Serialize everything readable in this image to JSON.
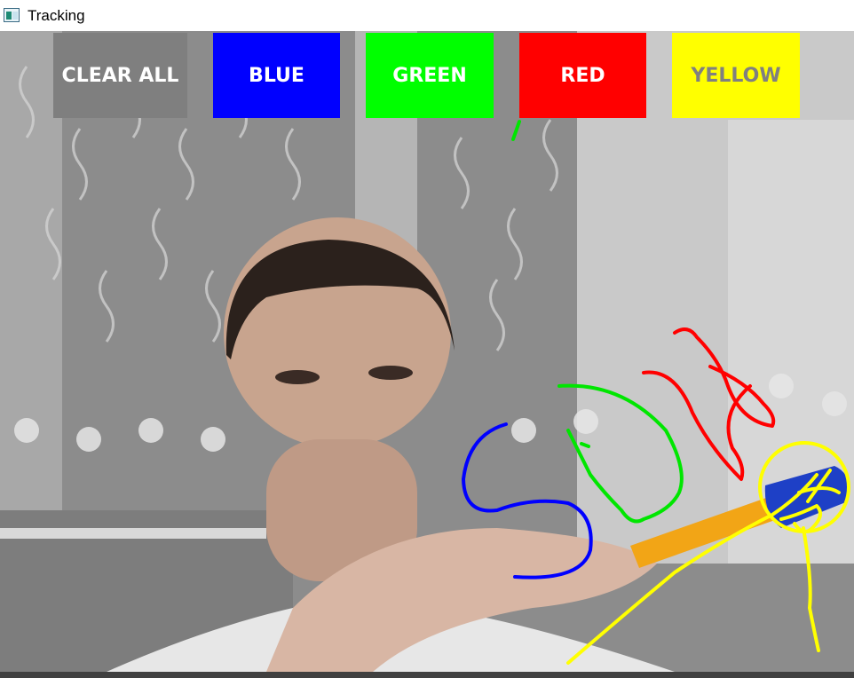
{
  "window": {
    "title": "Tracking",
    "icon": "app-window-icon"
  },
  "toolbar": {
    "buttons": [
      {
        "label": "CLEAR ALL",
        "bg": "#7f7f7f",
        "fg": "#ffffff"
      },
      {
        "label": "BLUE",
        "bg": "#0000ff",
        "fg": "#ffffff"
      },
      {
        "label": "GREEN",
        "bg": "#00ff00",
        "fg": "#ffffff"
      },
      {
        "label": "RED",
        "bg": "#ff0000",
        "fg": "#ffffff"
      },
      {
        "label": "YELLOW",
        "bg": "#ffff00",
        "fg": "#808080"
      }
    ]
  },
  "strokes": {
    "blue": "#0000ff",
    "green": "#00e600",
    "red": "#ff0000",
    "yellow": "#ffff00"
  },
  "tracker": {
    "marker_color": "#ffff00"
  }
}
